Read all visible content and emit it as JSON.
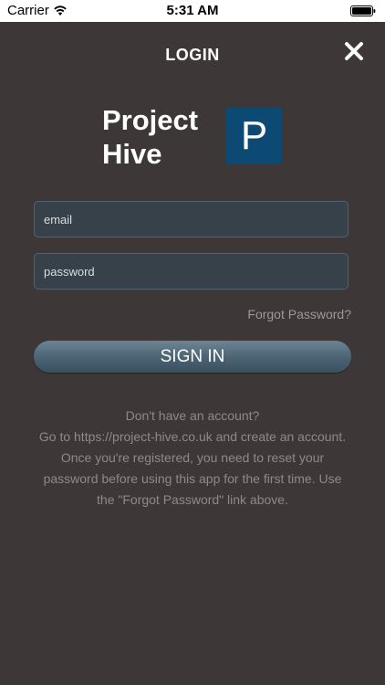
{
  "status_bar": {
    "carrier": "Carrier",
    "time": "5:31 AM",
    "wifi_icon": "wifi-icon",
    "battery_icon": "battery-icon"
  },
  "header": {
    "title": "LOGIN",
    "close_icon": "close-icon"
  },
  "logo": {
    "line1": "Project",
    "line2": "Hive",
    "mark": "P",
    "mark_color": "#0c4a73"
  },
  "form": {
    "email_placeholder": "email",
    "password_placeholder": "password",
    "forgot_label": "Forgot Password?",
    "signin_label": "SIGN IN"
  },
  "info": {
    "lines": [
      "Don't have an account?",
      "Go to https://project-hive.co.uk and create an account.",
      "Once you're registered, you need to reset your",
      "password before using this app for the first time. Use",
      "the \"Forgot Password\" link above."
    ]
  },
  "colors": {
    "background": "#3d3837",
    "button": "#4a6272",
    "field": "#36414a"
  }
}
